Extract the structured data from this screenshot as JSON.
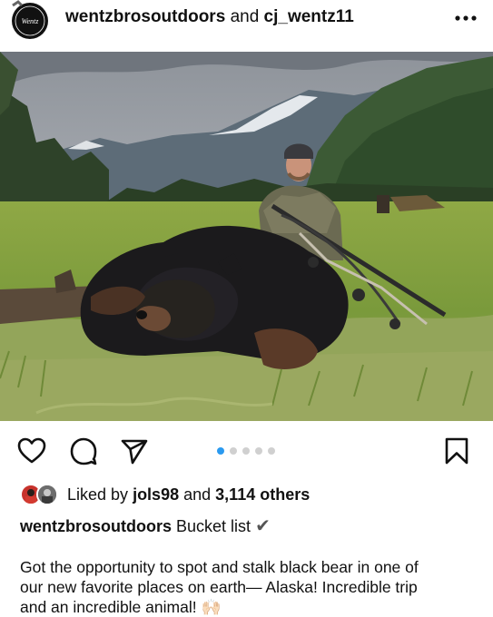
{
  "header": {
    "account_primary": "wentzbrosoutdoors",
    "joiner": "and",
    "account_secondary": "cj_wentz11",
    "avatar_icon": "wentz-brand-logo-icon",
    "more_icon": "more-horizontal-icon"
  },
  "post": {
    "photo_alt": "Hunter kneeling behind a harvested black bear with a compound bow in a grassy Alaska meadow with mountains",
    "carousel": {
      "count": 5,
      "active_index": 0
    }
  },
  "actions": {
    "like_icon": "heart-icon",
    "comment_icon": "comment-icon",
    "share_icon": "send-icon",
    "save_icon": "bookmark-icon"
  },
  "likes": {
    "prefix": "Liked by",
    "user": "jols98",
    "joiner": "and",
    "others": "3,114 others"
  },
  "caption": {
    "user": "wentzbrosoutdoors",
    "text": "Bucket list",
    "emoji": "✔",
    "body_lines": [
      "Got the opportunity to spot and stalk black bear in one of",
      "our new favorite places on earth— Alaska! Incredible trip",
      "and an incredible animal!"
    ],
    "body_emoji": "🙌🏻"
  },
  "colors": {
    "accent_dot": "#2a9af0",
    "inactive_dot": "#d0d0d0",
    "text": "#111111"
  }
}
